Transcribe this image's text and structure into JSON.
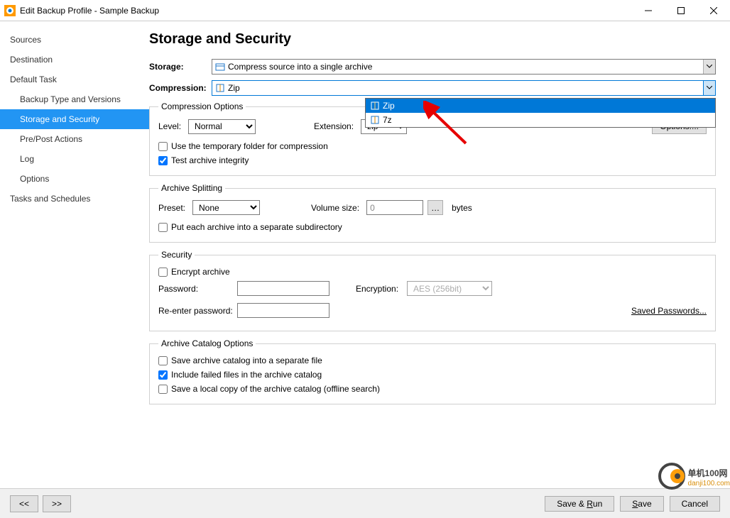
{
  "titlebar": {
    "title": "Edit Backup Profile - Sample Backup"
  },
  "sidebar": {
    "items": [
      {
        "label": "Sources",
        "type": "item"
      },
      {
        "label": "Destination",
        "type": "item"
      },
      {
        "label": "Default Task",
        "type": "item"
      },
      {
        "label": "Backup Type and Versions",
        "type": "subitem"
      },
      {
        "label": "Storage and Security",
        "type": "subitem",
        "active": true
      },
      {
        "label": "Pre/Post Actions",
        "type": "subitem"
      },
      {
        "label": "Log",
        "type": "subitem"
      },
      {
        "label": "Options",
        "type": "subitem"
      },
      {
        "label": "Tasks and Schedules",
        "type": "item"
      }
    ]
  },
  "heading": "Storage and Security",
  "storage": {
    "label": "Storage:",
    "value": "Compress source into a single archive"
  },
  "compression": {
    "label": "Compression:",
    "value": "Zip",
    "options": [
      "Zip",
      "7z"
    ],
    "selected": "Zip"
  },
  "comp_opts": {
    "legend": "Compression Options",
    "level_label": "Level:",
    "level_value": "Normal",
    "ext_label": "Extension:",
    "ext_value": "zip",
    "options_btn": "Options....",
    "temp_folder": "Use the temporary folder for compression",
    "temp_folder_checked": false,
    "test_integrity": "Test archive integrity",
    "test_integrity_checked": true
  },
  "split": {
    "legend": "Archive Splitting",
    "preset_label": "Preset:",
    "preset_value": "None",
    "volume_label": "Volume size:",
    "volume_value": "0",
    "volume_unit": "bytes",
    "subfolder": "Put each archive into a separate subdirectory",
    "subfolder_checked": false
  },
  "security": {
    "legend": "Security",
    "encrypt": "Encrypt archive",
    "encrypt_checked": false,
    "password_label": "Password:",
    "reenter_label": "Re-enter password:",
    "encryption_label": "Encryption:",
    "encryption_value": "AES (256bit)",
    "saved_link": "Saved Passwords..."
  },
  "catalog": {
    "legend": "Archive Catalog Options",
    "save_sep": "Save archive catalog into a separate file",
    "save_sep_checked": false,
    "include_failed": "Include failed files in the archive catalog",
    "include_failed_checked": true,
    "local_copy": "Save a local copy of the archive catalog (offline search)",
    "local_copy_checked": false
  },
  "buttons": {
    "prev": "<<",
    "next": ">>",
    "save_run": "Save & Run",
    "save": "Save",
    "cancel": "Cancel"
  },
  "watermark": {
    "brand": "单机100网",
    "url": "danji100.com"
  }
}
